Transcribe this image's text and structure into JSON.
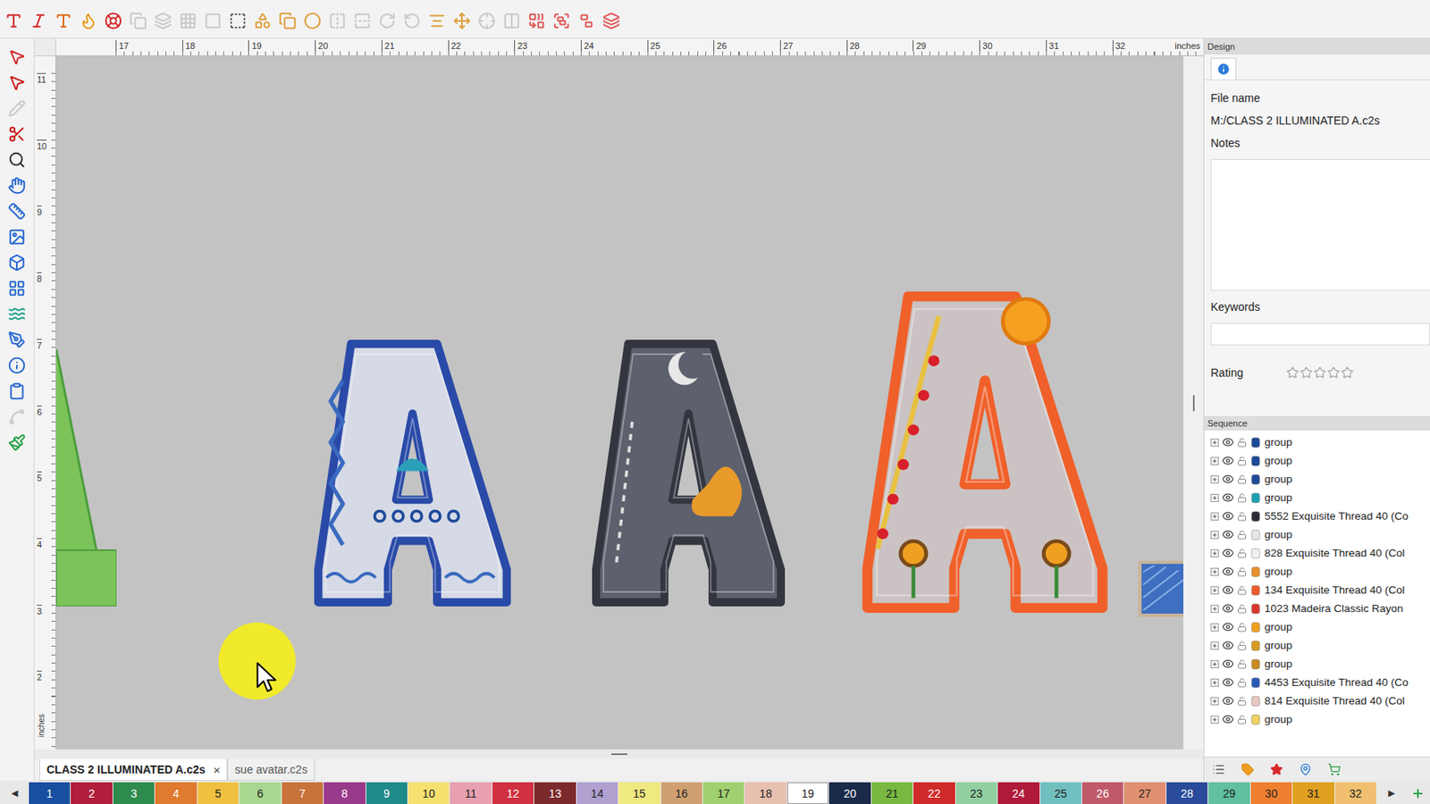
{
  "ruler": {
    "unit": "inches",
    "top": [
      "17",
      "18",
      "19",
      "20",
      "21",
      "22",
      "23",
      "24",
      "25",
      "26",
      "27",
      "28",
      "29",
      "30",
      "31",
      "32"
    ],
    "left": [
      "11",
      "10",
      "9",
      "8",
      "7",
      "6",
      "5",
      "4",
      "3",
      "2"
    ],
    "left_unit": "inches"
  },
  "designs": [
    {
      "kind": "partial",
      "color": "#4e9e3e",
      "fill": "#7cc45a"
    },
    {
      "kind": "letter",
      "color": "#2a4aa8",
      "fill": "#d6dae6"
    },
    {
      "kind": "letter",
      "color": "#33363f",
      "fill": "#5d616d"
    },
    {
      "kind": "letter",
      "color": "#f0602a",
      "fill": "#cbc3c3"
    },
    {
      "kind": "partial",
      "color": "#c8b49a",
      "fill": "#3f6fc0"
    }
  ],
  "design_panel": {
    "title": "Design",
    "file_name_label": "File name",
    "file_name": "M:/CLASS 2 ILLUMINATED A.c2s",
    "notes_label": "Notes",
    "notes": "",
    "keywords_label": "Keywords",
    "keywords": "",
    "rating_label": "Rating",
    "stars": 0
  },
  "sequence": {
    "title": "Sequence",
    "items": [
      {
        "label": "group",
        "color": "#1e4a9a",
        "visible": true,
        "locked": false,
        "expanded": false
      },
      {
        "label": "group",
        "color": "#1e4a9a",
        "visible": true,
        "locked": false,
        "expanded": false
      },
      {
        "label": "group",
        "color": "#1e4a9a",
        "visible": true,
        "locked": false,
        "expanded": false
      },
      {
        "label": "group",
        "color": "#1fa0b0",
        "visible": true,
        "locked": false,
        "expanded": false
      },
      {
        "label": "5552 Exquisite Thread 40 (Co",
        "color": "#2a2d38",
        "visible": true,
        "locked": false,
        "expanded": false
      },
      {
        "label": "group",
        "color": "#e6e6e6",
        "visible": true,
        "locked": false,
        "expanded": false
      },
      {
        "label": "828 Exquisite Thread 40 (Col",
        "color": "#f0f0f0",
        "visible": true,
        "locked": false,
        "expanded": false
      },
      {
        "label": "group",
        "color": "#e8902a",
        "visible": true,
        "locked": false,
        "expanded": false
      },
      {
        "label": "134 Exquisite Thread 40 (Col",
        "color": "#f05a2a",
        "visible": true,
        "locked": false,
        "expanded": false
      },
      {
        "label": "1023 Madeira Classic Rayon",
        "color": "#d83a2a",
        "visible": true,
        "locked": false,
        "expanded": false
      },
      {
        "label": "group",
        "color": "#f0a020",
        "visible": true,
        "locked": false,
        "expanded": false
      },
      {
        "label": "group",
        "color": "#d89a20",
        "visible": true,
        "locked": false,
        "expanded": false
      },
      {
        "label": "group",
        "color": "#c88a20",
        "visible": true,
        "locked": false,
        "expanded": false
      },
      {
        "label": "4453 Exquisite Thread 40 (Co",
        "color": "#2a5ab8",
        "visible": true,
        "locked": false,
        "expanded": false
      },
      {
        "label": "814 Exquisite Thread 40 (Col",
        "color": "#e8c8c0",
        "visible": true,
        "locked": false,
        "expanded": false
      },
      {
        "label": "group",
        "color": "#f0d060",
        "visible": true,
        "locked": false,
        "expanded": false
      }
    ]
  },
  "doc_tabs": [
    {
      "label": "CLASS 2 ILLUMINATED A.c2s",
      "selected": true,
      "close": "×"
    },
    {
      "label": "sue avatar.c2s",
      "selected": false,
      "close": ""
    }
  ],
  "palette": {
    "prev": "◀",
    "next": "▶",
    "colors": [
      {
        "label": "1",
        "color": "#1a4fa0",
        "selected": false
      },
      {
        "label": "2",
        "color": "#b01e3c",
        "selected": false
      },
      {
        "label": "3",
        "color": "#2e8b4e",
        "selected": false
      },
      {
        "label": "4",
        "color": "#e07a2e",
        "selected": false
      },
      {
        "label": "5",
        "color": "#f0c040",
        "selected": false
      },
      {
        "label": "6",
        "color": "#a8d890",
        "selected": false
      },
      {
        "label": "7",
        "color": "#c8733a",
        "selected": false
      },
      {
        "label": "8",
        "color": "#9a3a8a",
        "selected": false
      },
      {
        "label": "9",
        "color": "#1f8a8a",
        "selected": false
      },
      {
        "label": "10",
        "color": "#f5e070",
        "selected": false
      },
      {
        "label": "11",
        "color": "#e8a0b0",
        "selected": false
      },
      {
        "label": "12",
        "color": "#d03040",
        "selected": false
      },
      {
        "label": "13",
        "color": "#7a2a2a",
        "selected": false
      },
      {
        "label": "14",
        "color": "#b0a0d0",
        "selected": false
      },
      {
        "label": "15",
        "color": "#f0e880",
        "selected": false
      },
      {
        "label": "16",
        "color": "#d0a070",
        "selected": false
      },
      {
        "label": "17",
        "color": "#a0d070",
        "selected": false
      },
      {
        "label": "18",
        "color": "#e8c0b0",
        "selected": false
      },
      {
        "label": "19",
        "color": "#ffffff",
        "selected": true
      },
      {
        "label": "20",
        "color": "#1a2a4a",
        "selected": false
      },
      {
        "label": "21",
        "color": "#78b840",
        "selected": false
      },
      {
        "label": "22",
        "color": "#d02a2a",
        "selected": false
      },
      {
        "label": "23",
        "color": "#90d0a0",
        "selected": false
      },
      {
        "label": "24",
        "color": "#b01a3a",
        "selected": false
      },
      {
        "label": "25",
        "color": "#70c0c0",
        "selected": false
      },
      {
        "label": "26",
        "color": "#c05a6a",
        "selected": false
      },
      {
        "label": "27",
        "color": "#e09070",
        "selected": false
      },
      {
        "label": "28",
        "color": "#2a4a9a",
        "selected": false
      },
      {
        "label": "29",
        "color": "#60c0a0",
        "selected": false
      },
      {
        "label": "30",
        "color": "#f08030",
        "selected": false
      },
      {
        "label": "31",
        "color": "#e0a020",
        "selected": false
      },
      {
        "label": "32",
        "color": "#f0c070",
        "selected": false
      }
    ]
  }
}
